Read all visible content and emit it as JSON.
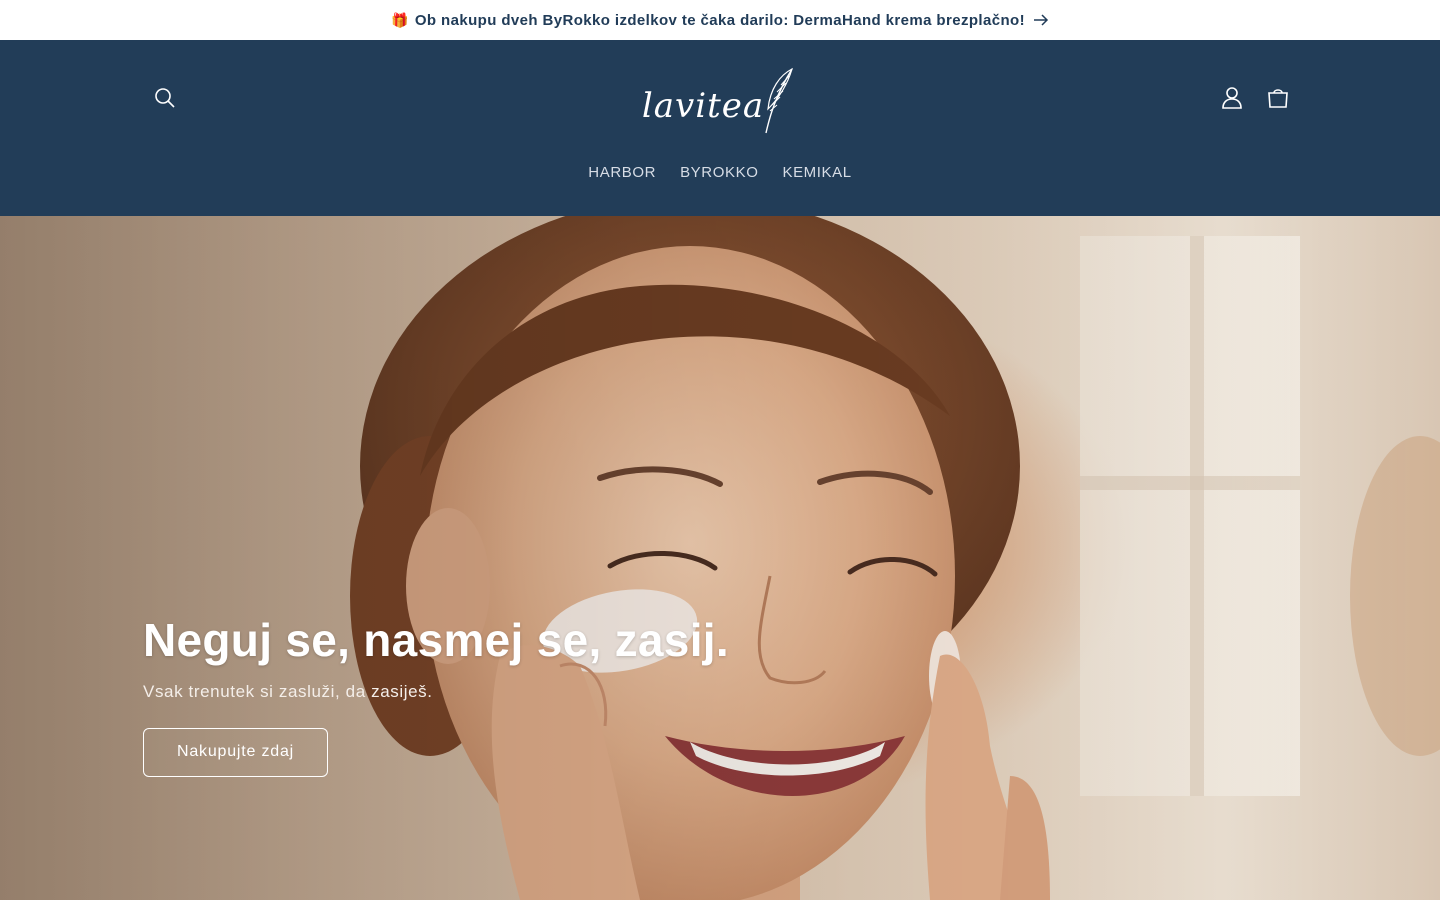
{
  "announcement": {
    "gift_icon": "gift-icon",
    "text": "Ob nakupu dveh ByRokko izdelkov te čaka darilo: DermaHand krema brezplačno!",
    "arrow_icon": "arrow-right-icon"
  },
  "header": {
    "logo_text": "lavitea",
    "icons": {
      "search": "search-icon",
      "account": "user-icon",
      "cart": "cart-icon"
    },
    "colors": {
      "background": "#223d58",
      "text": "#ffffff"
    }
  },
  "nav": {
    "items": [
      {
        "label": "HARBOR"
      },
      {
        "label": "BYROKKO"
      },
      {
        "label": "KEMIKAL"
      }
    ]
  },
  "hero": {
    "title": "Neguj se, nasmej se, zasij.",
    "subtitle": "Vsak trenutek si zasluži, da zasiješ.",
    "cta_label": "Nakupujte zdaj"
  }
}
